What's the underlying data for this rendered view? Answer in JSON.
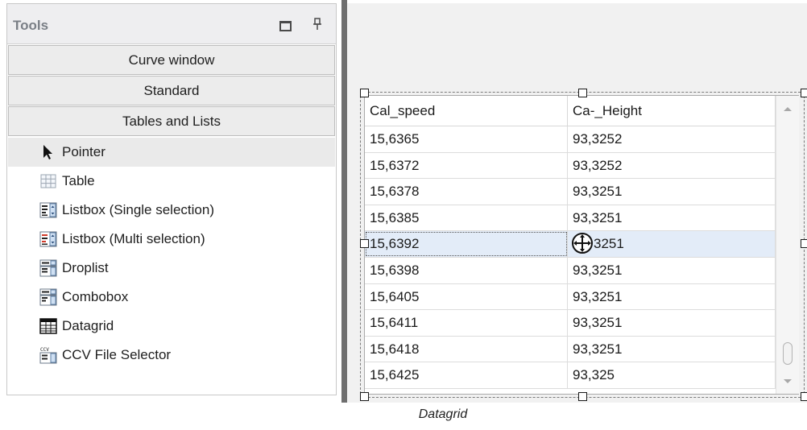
{
  "tools": {
    "title": "Tools",
    "categories": [
      "Curve window",
      "Standard",
      "Tables and Lists"
    ],
    "items": [
      {
        "label": "Pointer",
        "icon": "pointer-arrow-icon",
        "selected": true
      },
      {
        "label": "Table",
        "icon": "table-icon",
        "selected": false
      },
      {
        "label": "Listbox (Single selection)",
        "icon": "listbox-single-icon",
        "selected": false
      },
      {
        "label": "Listbox (Multi selection)",
        "icon": "listbox-multi-icon",
        "selected": false
      },
      {
        "label": "Droplist",
        "icon": "droplist-icon",
        "selected": false
      },
      {
        "label": "Combobox",
        "icon": "combobox-icon",
        "selected": false
      },
      {
        "label": "Datagrid",
        "icon": "datagrid-icon",
        "selected": false
      },
      {
        "label": "CCV File Selector",
        "icon": "ccv-file-selector-icon",
        "selected": false
      }
    ]
  },
  "datagrid": {
    "columns": [
      "Cal_speed",
      "Ca-_Height"
    ],
    "rows": [
      [
        "15,6365",
        "93,3252"
      ],
      [
        "15,6372",
        "93,3252"
      ],
      [
        "15,6378",
        "93,3251"
      ],
      [
        "15,6385",
        "93,3251"
      ],
      [
        "15,6392",
        "3251"
      ],
      [
        "15,6398",
        "93,3251"
      ],
      [
        "15,6405",
        "93,3251"
      ],
      [
        "15,6411",
        "93,3251"
      ],
      [
        "15,6418",
        "93,3251"
      ],
      [
        "15,6425",
        "93,325"
      ]
    ],
    "current_row": 4
  },
  "caption": "Datagrid",
  "colors": {
    "splitter": "#6e6e6e",
    "header_text": "#7a7f86",
    "selected_row": "#e3ecf8"
  }
}
